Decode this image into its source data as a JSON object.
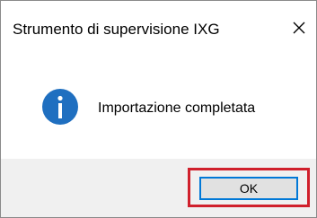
{
  "dialog": {
    "title": "Strumento di supervisione IXG",
    "close_icon": "close-icon",
    "message_icon": "info-icon",
    "message": "Importazione completata",
    "ok_label": "OK"
  },
  "colors": {
    "info_icon": "#1f6fc0",
    "highlight": "#d0202c",
    "button_focus": "#0078d7",
    "button_bg": "#e1e1e1",
    "footer_bg": "#f0f0f0"
  }
}
